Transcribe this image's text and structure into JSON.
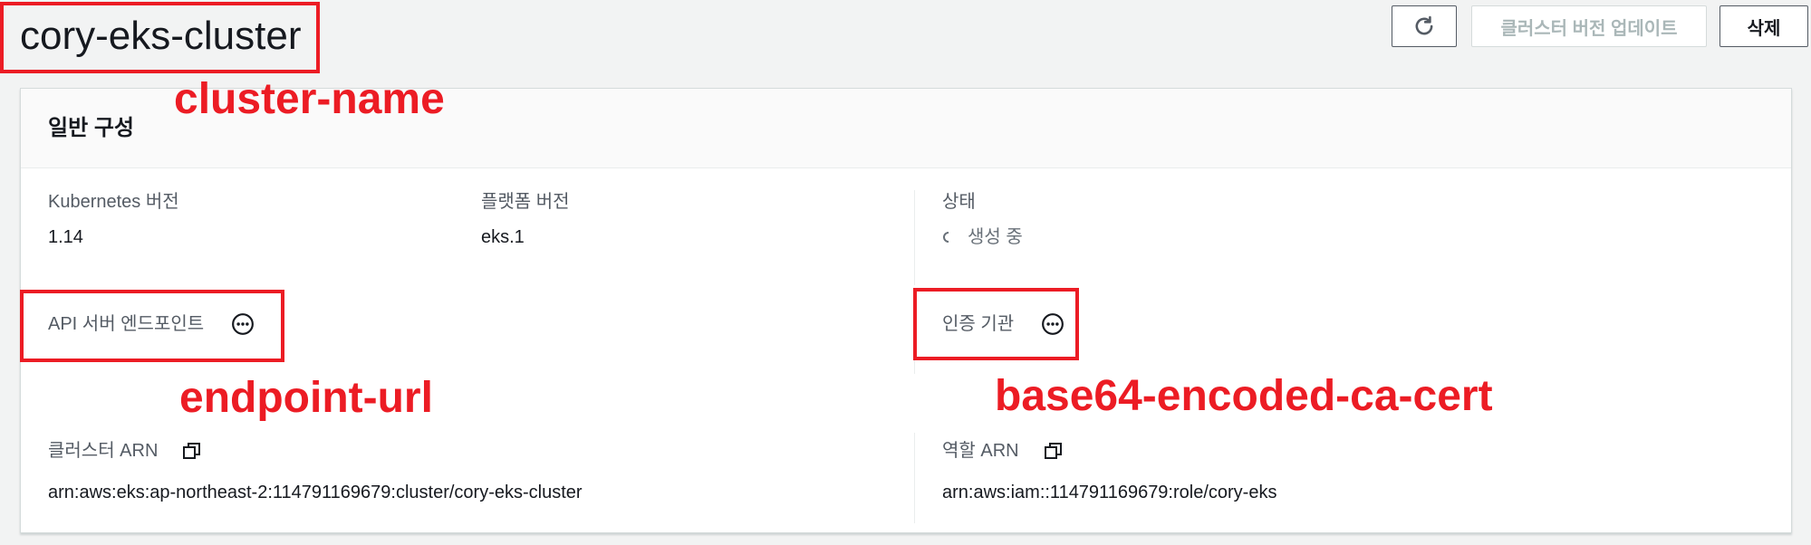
{
  "header": {
    "cluster_title": "cory-eks-cluster",
    "update_button": "클러스터 버전 업데이트",
    "delete_button": "삭제",
    "refresh_icon": "refresh-icon"
  },
  "general_config": {
    "title": "일반 구성",
    "kubernetes_version_label": "Kubernetes 버전",
    "kubernetes_version_value": "1.14",
    "platform_version_label": "플랫폼 버전",
    "platform_version_value": "eks.1",
    "status_label": "상태",
    "status_value": "생성 중",
    "api_endpoint_label": "API 서버 엔드포인트",
    "ca_label": "인증 기관",
    "cluster_arn_label": "클러스터 ARN",
    "cluster_arn_value": "arn:aws:eks:ap-northeast-2:114791169679:cluster/cory-eks-cluster",
    "role_arn_label": "역할 ARN",
    "role_arn_value": "arn:aws:iam::114791169679:role/cory-eks"
  },
  "annotations": {
    "cluster_name": "cluster-name",
    "endpoint_url": "endpoint-url",
    "ca_cert": "base64-encoded-ca-cert"
  },
  "colors": {
    "annotation_red": "#ec1c24",
    "page_bg": "#f2f3f3",
    "text_primary": "#16191f",
    "text_secondary": "#545b64"
  }
}
